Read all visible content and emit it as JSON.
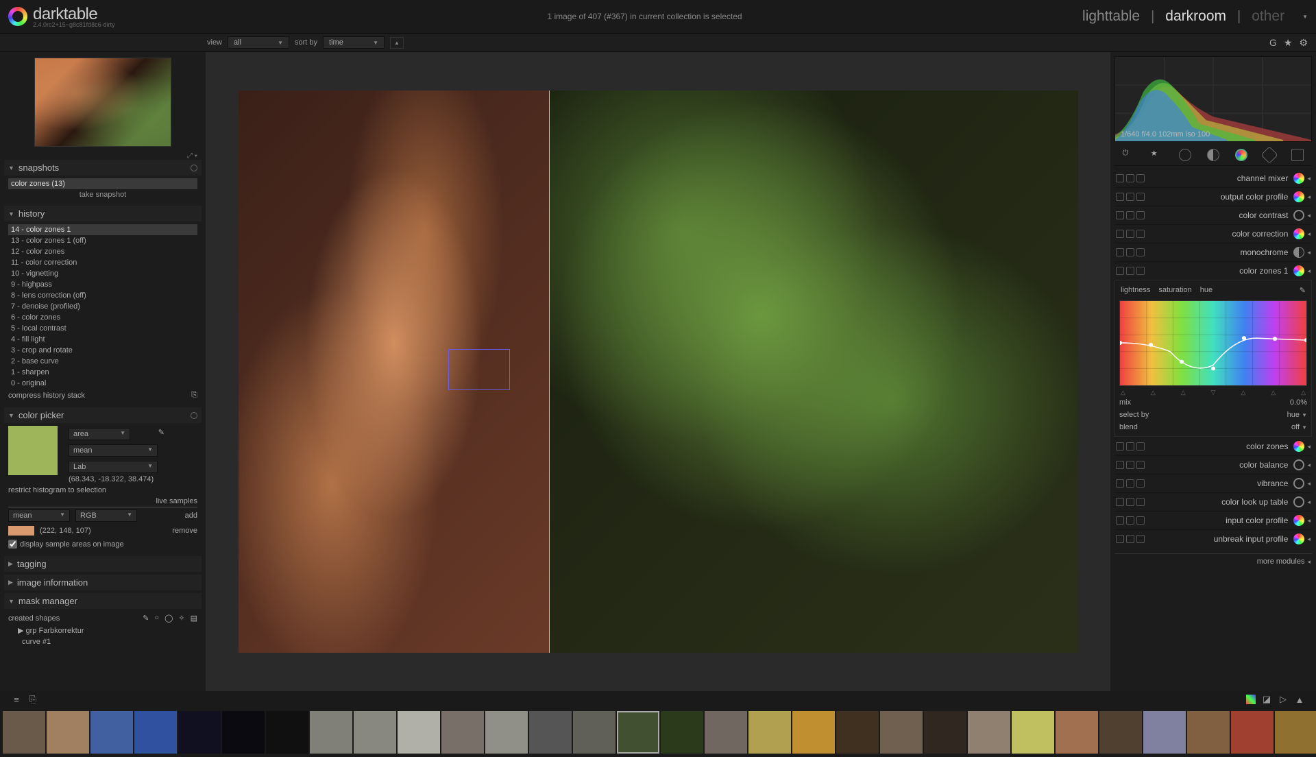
{
  "app": {
    "name": "darktable",
    "version": "2.4.0rc2+15~g8c81fd8c6-dirty"
  },
  "top": {
    "status": "1 image of 407 (#367) in current collection is selected"
  },
  "views": {
    "lighttable": "lighttable",
    "darkroom": "darkroom",
    "other": "other"
  },
  "sec": {
    "view": "view",
    "view_val": "all",
    "sort": "sort by",
    "sort_val": "time"
  },
  "left": {
    "snapshots": {
      "title": "snapshots",
      "item": "color zones (13)",
      "take": "take snapshot"
    },
    "history": {
      "title": "history",
      "items": [
        "14 - color zones 1",
        "13 - color zones 1 (off)",
        "12 - color zones",
        "11 - color correction",
        "10 - vignetting",
        "9 - highpass",
        "8 - lens correction (off)",
        "7 - denoise (profiled)",
        "6 - color zones",
        "5 - local contrast",
        "4 - fill light",
        "3 - crop and rotate",
        "2 - base curve",
        "1 - sharpen",
        "0 - original"
      ],
      "compress": "compress history stack"
    },
    "picker": {
      "title": "color picker",
      "mode": "area",
      "stat": "mean",
      "space": "Lab",
      "lab": "(68.343, -18.322, 38.474)",
      "restrict": "restrict histogram to selection",
      "live": "live samples",
      "mean2": "mean",
      "rgb": "RGB",
      "add": "add",
      "sample_rgb": "(222, 148, 107)",
      "remove": "remove",
      "display": "display sample areas on image"
    },
    "tagging": "tagging",
    "imginfo": "image information",
    "mask": "mask manager",
    "mask_body": {
      "created": "created shapes",
      "grp": "grp Farbkorrektur",
      "curve": "curve #1"
    }
  },
  "right": {
    "histo_info": "1/640 f/4.0 102mm iso 100",
    "modules": [
      "channel mixer",
      "output color profile",
      "color contrast",
      "color correction",
      "monochrome",
      "color zones 1"
    ],
    "cz": {
      "tabs": [
        "lightness",
        "saturation",
        "hue"
      ],
      "mix": "mix",
      "mix_val": "0.0%",
      "select": "select by",
      "select_val": "hue",
      "blend": "blend",
      "blend_val": "off"
    },
    "modules2": [
      "color zones",
      "color balance",
      "vibrance",
      "color look up table",
      "input color profile",
      "unbreak input profile"
    ],
    "more": "more modules"
  },
  "filmstrip_count": 30
}
